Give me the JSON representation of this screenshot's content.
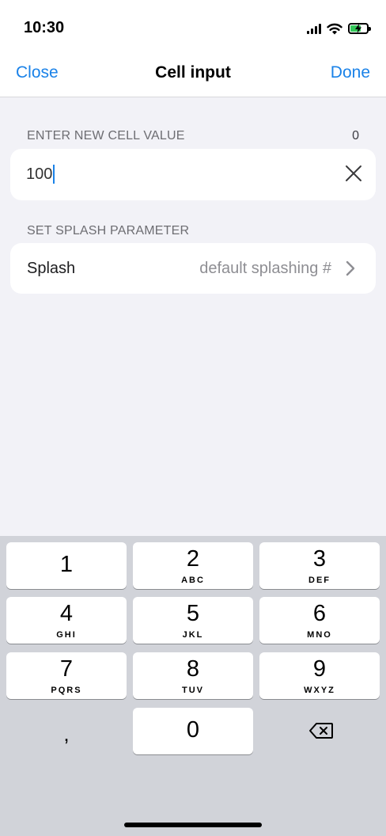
{
  "status_bar": {
    "time": "10:30"
  },
  "nav": {
    "close_label": "Close",
    "title": "Cell input",
    "done_label": "Done"
  },
  "cell_section": {
    "header": "ENTER NEW CELL VALUE",
    "count": "0",
    "input_value": "100"
  },
  "splash_section": {
    "header": "SET SPLASH PARAMETER",
    "label": "Splash",
    "value": "default splashing #"
  },
  "keyboard": {
    "keys": [
      {
        "digit": "1",
        "letters": ""
      },
      {
        "digit": "2",
        "letters": "ABC"
      },
      {
        "digit": "3",
        "letters": "DEF"
      },
      {
        "digit": "4",
        "letters": "GHI"
      },
      {
        "digit": "5",
        "letters": "JKL"
      },
      {
        "digit": "6",
        "letters": "MNO"
      },
      {
        "digit": "7",
        "letters": "PQRS"
      },
      {
        "digit": "8",
        "letters": "TUV"
      },
      {
        "digit": "9",
        "letters": "WXYZ"
      },
      {
        "digit": "0",
        "letters": ""
      }
    ],
    "comma": ","
  },
  "colors": {
    "accent": "#1a82e8",
    "battery": "#34c759",
    "background": "#f2f2f7"
  }
}
